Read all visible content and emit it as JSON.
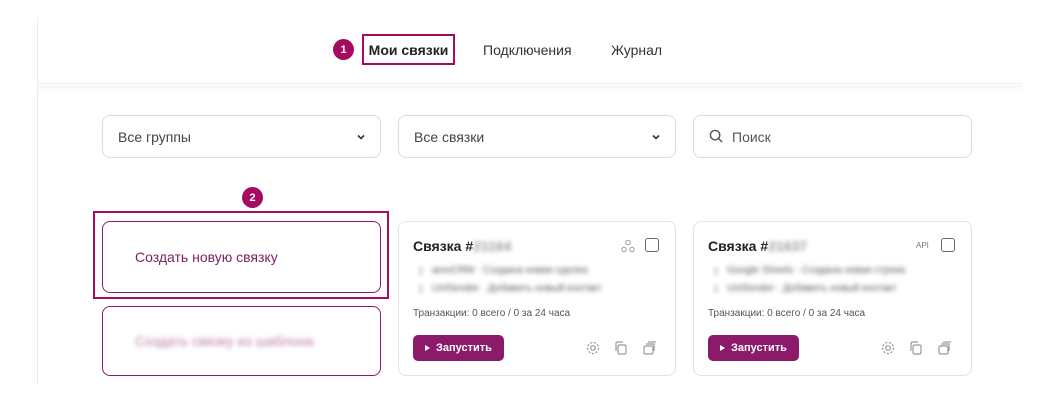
{
  "tabs": {
    "active_badge": "1",
    "items": [
      {
        "label": "Мои связки",
        "active": true
      },
      {
        "label": "Подключения",
        "active": false
      },
      {
        "label": "Журнал",
        "active": false
      }
    ]
  },
  "filters": {
    "groups_value": "Все группы",
    "links_value": "Все связки",
    "search_placeholder": "Поиск"
  },
  "create": {
    "badge": "2",
    "new_link_label": "Создать новую связку",
    "from_template_label": "Создать связку из шаблона"
  },
  "cards": [
    {
      "title": "Связка #",
      "title_id": "21164",
      "line1": "amoCRM · Создана новая сделка",
      "line2": "UniSender · Добавить новый контакт",
      "transactions": "Транзакции: 0 всего / 0 за 24 часа",
      "run_label": "Запустить",
      "tag": ""
    },
    {
      "title": "Связка #",
      "title_id": "21637",
      "line1": "Google Sheets · Создана новая строка",
      "line2": "UniSender · Добавить новый контакт",
      "transactions": "Транзакции: 0 всего / 0 за 24 часа",
      "run_label": "Запустить",
      "tag": "API"
    }
  ],
  "colors": {
    "accent": "#a50a60",
    "button": "#8c1a6a"
  }
}
